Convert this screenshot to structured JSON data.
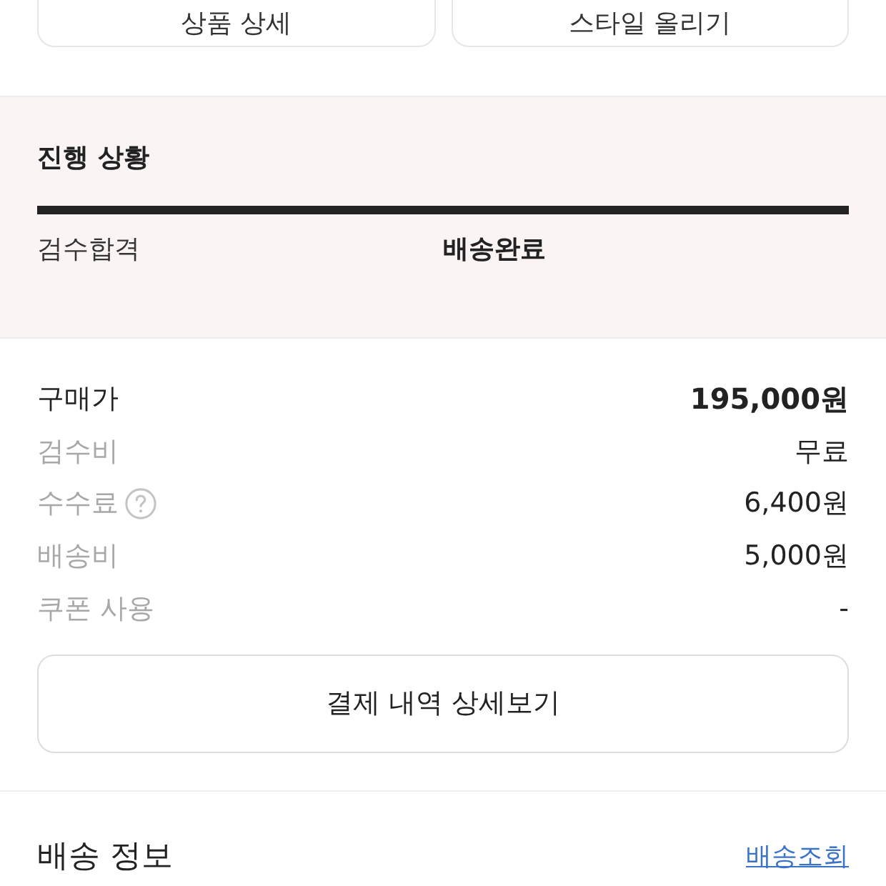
{
  "top_buttons": [
    "상품 상세",
    "스타일 올리기"
  ],
  "progress": {
    "title": "진행 상황",
    "level": 1,
    "steps": [
      {
        "label": "검수합격",
        "current": false
      },
      {
        "label": "배송완료",
        "current": true
      }
    ]
  },
  "payment_rows": [
    {
      "label": "구매가",
      "value": "195,000원",
      "emphasis": true,
      "help": false
    },
    {
      "label": "검수비",
      "value": "무료",
      "emphasis": false,
      "help": false
    },
    {
      "label": "수수료",
      "value": "6,400원",
      "emphasis": false,
      "help": true
    },
    {
      "label": "배송비",
      "value": "5,000원",
      "emphasis": false,
      "help": false
    },
    {
      "label": "쿠폰 사용",
      "value": "-",
      "emphasis": false,
      "help": false
    }
  ],
  "detail_button": "결제 내역 상세보기",
  "shipping": {
    "title": "배송 정보",
    "link": "배송조회"
  }
}
